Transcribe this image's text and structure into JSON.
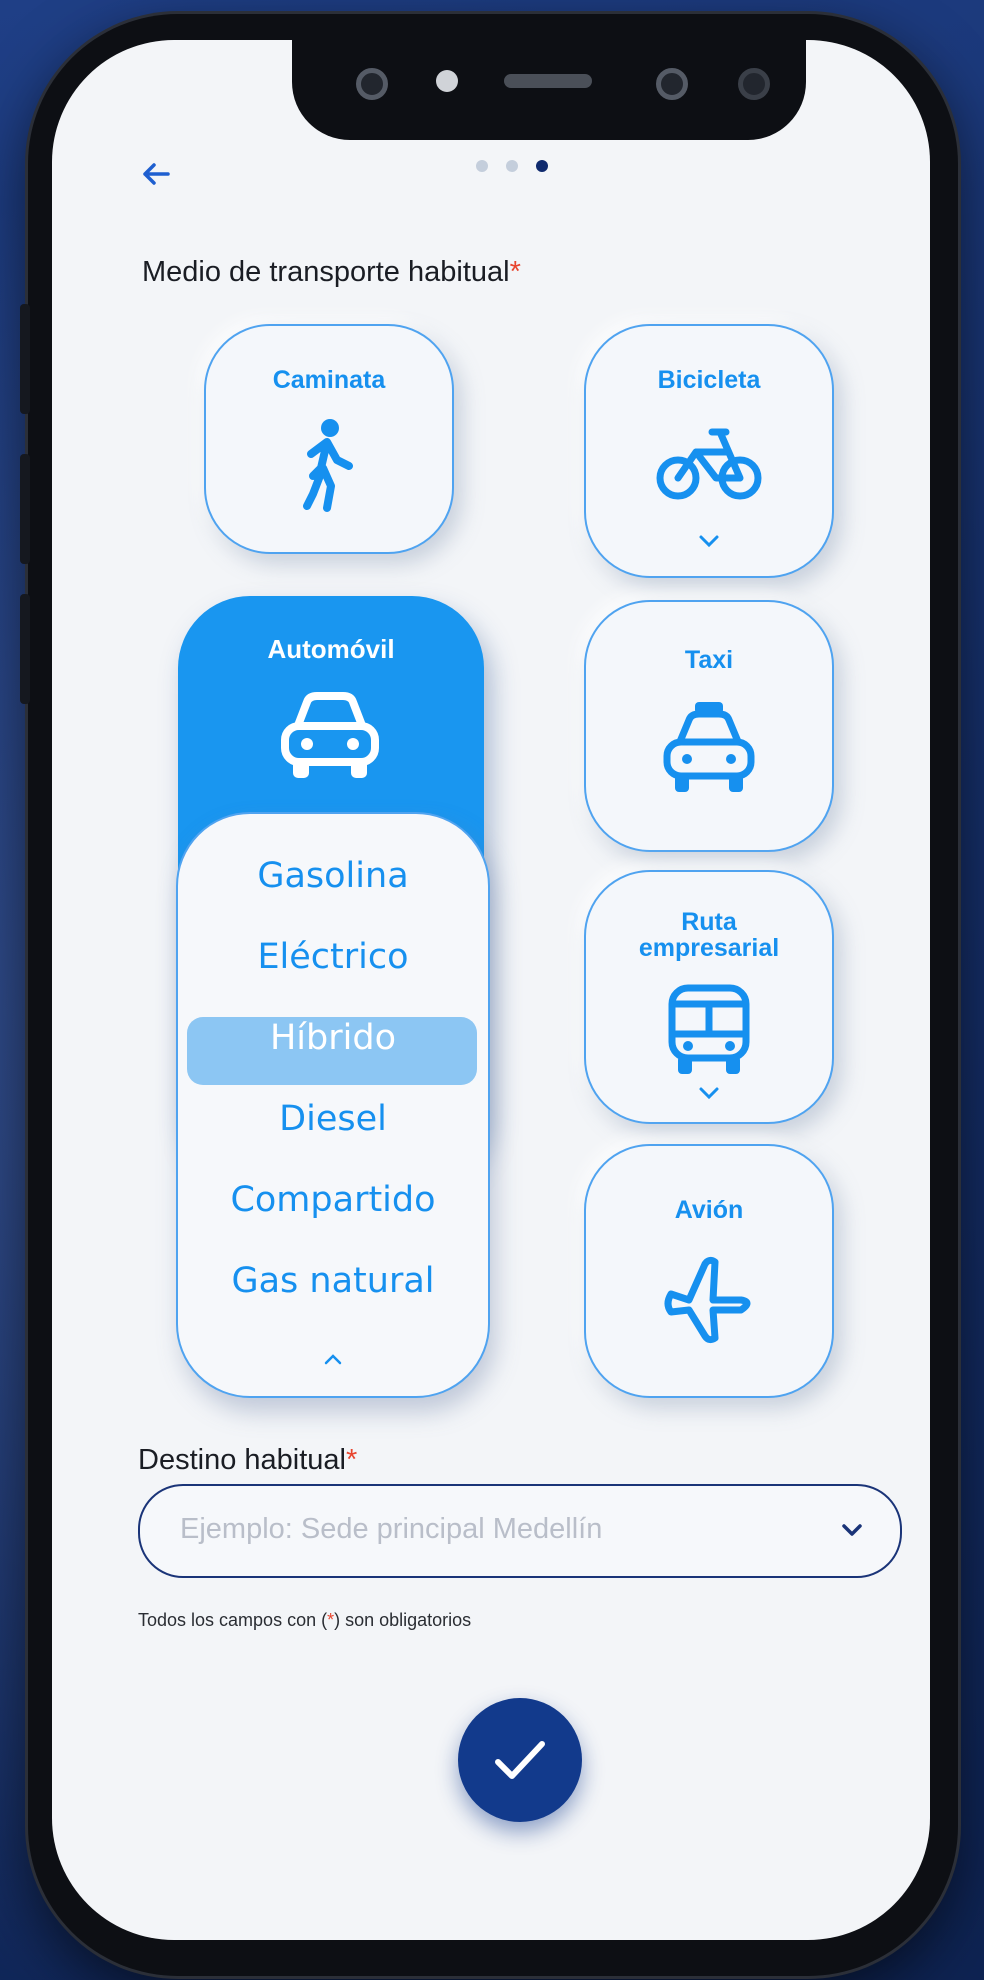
{
  "header": {
    "back_icon": "arrow-left-icon",
    "step_total": 3,
    "step_current": 3
  },
  "transport": {
    "label": "Medio de transporte habitual",
    "required_mark": "*",
    "options": {
      "caminata": {
        "label": "Caminata",
        "icon": "walking-person-icon"
      },
      "bicicleta": {
        "label": "Bicicleta",
        "icon": "bicycle-icon"
      },
      "automovil": {
        "label": "Automóvil",
        "icon": "car-icon"
      },
      "taxi": {
        "label": "Taxi",
        "icon": "taxi-icon"
      },
      "ruta": {
        "label_line1": "Ruta",
        "label_line2": "empresarial",
        "icon": "bus-icon"
      },
      "avion": {
        "label": "Avión",
        "icon": "airplane-icon"
      }
    },
    "fuel_options": [
      "Gasolina",
      "Eléctrico",
      "Híbrido",
      "Diesel",
      "Compartido",
      "Gas natural"
    ],
    "fuel_selected": "Híbrido"
  },
  "destination": {
    "label": "Destino habitual",
    "required_mark": "*",
    "placeholder": "Ejemplo: Sede principal Medellín"
  },
  "footnote": {
    "before": "Todos los campos con (",
    "mark": "*",
    "after": ") son obligatorios"
  },
  "colors": {
    "accent": "#1996f0",
    "navy": "#123a8c",
    "required": "#e8452f",
    "selected_option": "#8cc6f3"
  }
}
